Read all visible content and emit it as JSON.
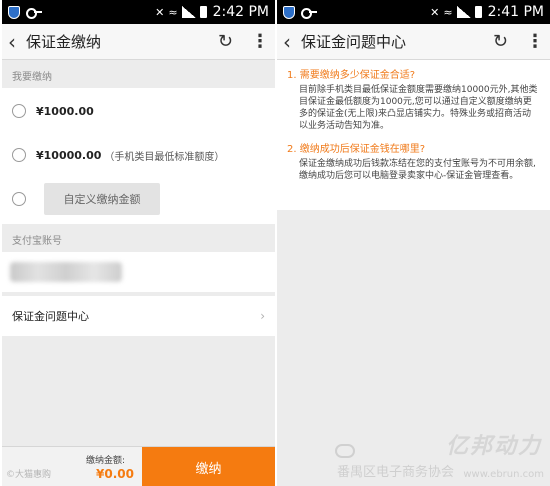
{
  "status_left": {
    "time": "2:42 PM"
  },
  "status_right": {
    "time": "2:41 PM"
  },
  "left_screen": {
    "title": "保证金缴纳",
    "section_payment_label": "我要缴纳",
    "options": [
      {
        "amount": "¥1000.00",
        "hint": ""
      },
      {
        "amount": "¥10000.00",
        "hint": "（手机类目最低标准额度）"
      }
    ],
    "custom_placeholder": "自定义缴纳金额",
    "section_account_label": "支付宝账号",
    "faq_link": "保证金问题中心",
    "sum_label": "缴纳金额:",
    "sum_value": "¥0.00",
    "pay_button": "缴纳",
    "watermark": "©大猫惠购"
  },
  "right_screen": {
    "title": "保证金问题中心",
    "faq": [
      {
        "q": "1. 需要缴纳多少保证金合适?",
        "a": "目前除手机类目最低保证金额度需要缴纳10000元外,其他类目保证金最低额度为1000元,您可以通过自定义额度缴纳更多的保证金(无上限)来凸显店铺实力。特殊业务或招商活动以业务活动告知为准。"
      },
      {
        "q": "2. 缴纳成功后保证金钱在哪里?",
        "a": "保证金缴纳成功后钱款冻结在您的支付宝账号为不可用余额,缴纳成功后您可以电脑登录卖家中心-保证金管理查看。"
      }
    ],
    "brand_mark": "亿邦动力",
    "brand_sub": "番禺区电子商务协会",
    "brand_url": "www.ebrun.com"
  },
  "icons": {
    "back": "back-chevron-icon",
    "refresh": "refresh-icon",
    "more": "more-vertical-icon"
  },
  "colors": {
    "accent": "#f57b10",
    "faq_question": "#f07a1a"
  }
}
